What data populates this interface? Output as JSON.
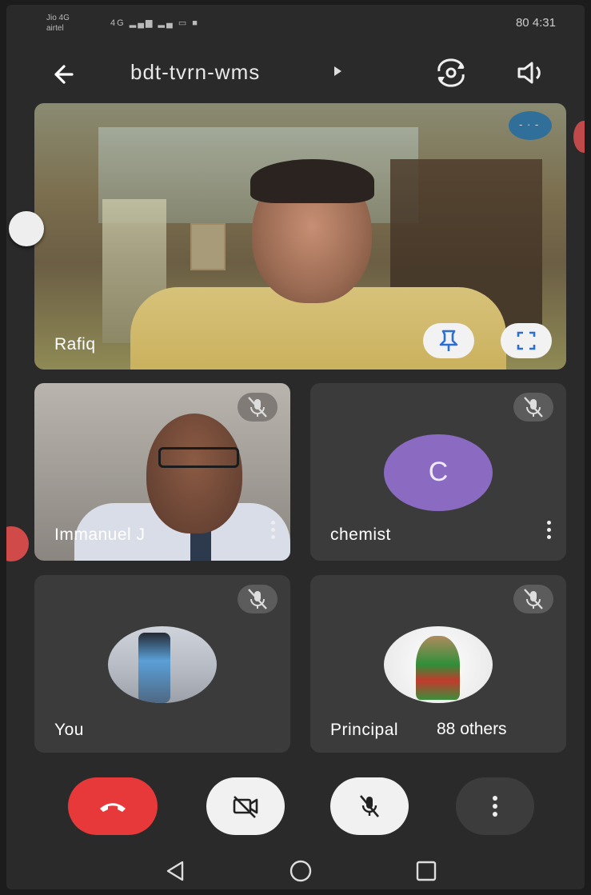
{
  "status_bar": {
    "carrier_1": "Jio 4G",
    "carrier_2": "airtel",
    "signal": "4G",
    "time": "4:31",
    "battery": "80"
  },
  "header": {
    "meeting_code": "bdt-tvrn-wms"
  },
  "tiles": {
    "main": {
      "name": "Rafiq"
    },
    "t1": {
      "name": "Immanuel J"
    },
    "t2": {
      "name": "chemist",
      "avatar_letter": "C"
    },
    "t3": {
      "name": "You"
    },
    "t4": {
      "name": "Principal",
      "others": "88 others"
    }
  },
  "colors": {
    "hangup": "#e8393a",
    "avatar_purple": "#8b6bc2"
  }
}
